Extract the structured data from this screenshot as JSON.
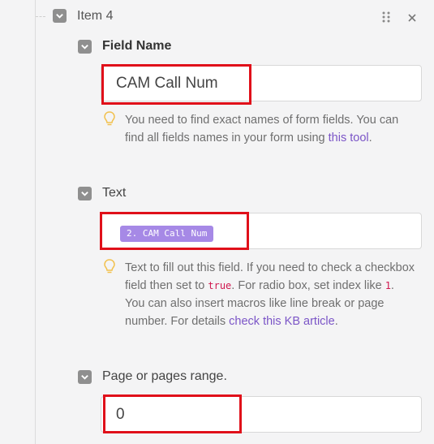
{
  "item": {
    "title": "Item 4"
  },
  "field_name": {
    "label": "Field Name",
    "value": "CAM Call Num",
    "hint_before": "You need to find exact names of form fields. You can find all fields names in your form using ",
    "hint_link": "this tool",
    "hint_after": "."
  },
  "text": {
    "label": "Text",
    "pill": "2. CAM Call Num",
    "hint_1": "Text to fill out this field. If you need to check a checkbox field then set to ",
    "hint_true": "true",
    "hint_2": ". For radio box, set index like ",
    "hint_1_code": "1",
    "hint_3": ". You can also insert macros like line break or page number. For details ",
    "hint_link": "check this KB article",
    "hint_4": "."
  },
  "page_range": {
    "label": "Page or pages range.",
    "value": "0"
  },
  "icons": [
    "drag-handle-icon",
    "close-icon",
    "checkbox-icon",
    "lightbulb-icon"
  ]
}
